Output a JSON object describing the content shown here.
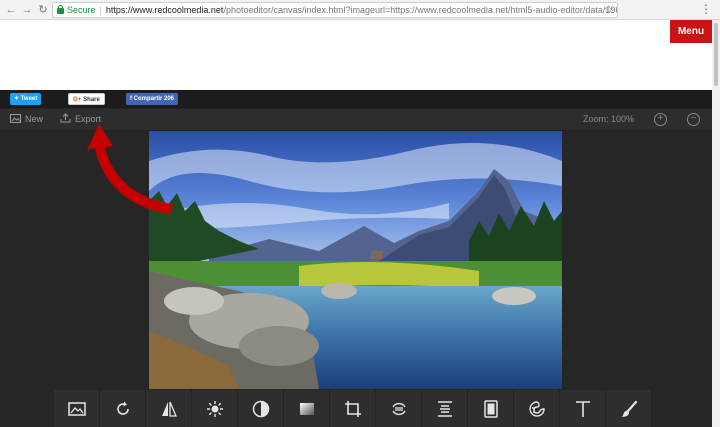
{
  "browser": {
    "back_icon": "arrow-left-icon",
    "forward_icon": "arrow-right-icon",
    "reload_icon": "reload-icon",
    "secure_label": "Secure",
    "url_host": "https://www.redcoolmedia.net",
    "url_path": "/photoeditor/canvas/index.html?imageurl=https://www.redcoolmedia.net/html5-audio-editor/data/196..."
  },
  "page": {
    "menu_label": "Menu",
    "menu_color": "#c81414"
  },
  "share": {
    "tweet_label": "Tweet",
    "gplus_label": "Share",
    "facebook_label": "Compartir 206"
  },
  "editor": {
    "new_label": "New",
    "export_label": "Export",
    "zoom_label": "Zoom: 100%",
    "zoom_in_icon": "plus-circle-icon",
    "zoom_out_icon": "minus-circle-icon",
    "background": "#262626",
    "annotation_arrow_color": "#c40000"
  },
  "tools": [
    {
      "name": "image-icon"
    },
    {
      "name": "rotate-icon"
    },
    {
      "name": "flip-icon"
    },
    {
      "name": "brightness-icon"
    },
    {
      "name": "contrast-icon"
    },
    {
      "name": "gradient-icon"
    },
    {
      "name": "crop-icon"
    },
    {
      "name": "orientation-icon"
    },
    {
      "name": "align-icon"
    },
    {
      "name": "frame-icon"
    },
    {
      "name": "sticker-icon"
    },
    {
      "name": "text-icon"
    },
    {
      "name": "brush-icon"
    }
  ]
}
